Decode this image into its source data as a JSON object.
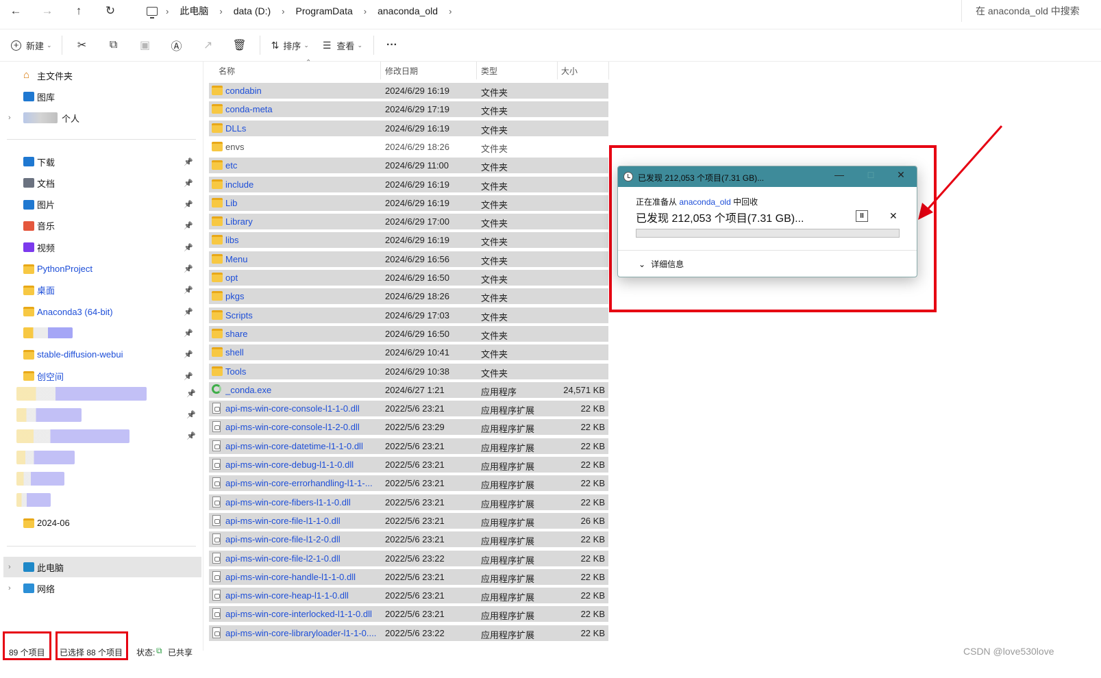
{
  "nav": {
    "back": "←",
    "forward": "→",
    "up": "↑",
    "refresh": "↻"
  },
  "breadcrumb": [
    "此电脑",
    "data (D:)",
    "ProgramData",
    "anaconda_old"
  ],
  "search": {
    "placeholder": "在 anaconda_old 中搜索"
  },
  "toolbar": {
    "new_label": "新建",
    "sort_label": "排序",
    "view_label": "查看",
    "more": "···"
  },
  "sidebar": {
    "home": "主文件夹",
    "gallery": "图库",
    "personal": "个人",
    "quick": [
      {
        "label": "下载",
        "icon": "download-icon"
      },
      {
        "label": "文档",
        "icon": "document-icon"
      },
      {
        "label": "图片",
        "icon": "pictures-icon"
      },
      {
        "label": "音乐",
        "icon": "music-icon"
      },
      {
        "label": "视频",
        "icon": "video-icon"
      },
      {
        "label": "PythonProject",
        "icon": "folder-icon"
      },
      {
        "label": "桌面",
        "icon": "folder-icon"
      },
      {
        "label": "Anaconda3 (64-bit)",
        "icon": "folder-icon"
      },
      {
        "label": "",
        "icon": "folder-icon"
      },
      {
        "label": "stable-diffusion-webui",
        "icon": "folder-icon"
      },
      {
        "label": "创空间",
        "icon": "folder-icon"
      }
    ],
    "last_folder": "2024-06",
    "this_pc": "此电脑",
    "network": "网络"
  },
  "columns": {
    "name": "名称",
    "date": "修改日期",
    "type": "类型",
    "size": "大小"
  },
  "files": [
    {
      "name": "condabin",
      "date": "2024/6/29 16:19",
      "type": "文件夹",
      "size": "",
      "kind": "folder",
      "selected": true
    },
    {
      "name": "conda-meta",
      "date": "2024/6/29 17:19",
      "type": "文件夹",
      "size": "",
      "kind": "folder",
      "selected": true
    },
    {
      "name": "DLLs",
      "date": "2024/6/29 16:19",
      "type": "文件夹",
      "size": "",
      "kind": "folder",
      "selected": true
    },
    {
      "name": "envs",
      "date": "2024/6/29 18:26",
      "type": "文件夹",
      "size": "",
      "kind": "folder",
      "selected": false
    },
    {
      "name": "etc",
      "date": "2024/6/29 11:00",
      "type": "文件夹",
      "size": "",
      "kind": "folder",
      "selected": true
    },
    {
      "name": "include",
      "date": "2024/6/29 16:19",
      "type": "文件夹",
      "size": "",
      "kind": "folder",
      "selected": true
    },
    {
      "name": "Lib",
      "date": "2024/6/29 16:19",
      "type": "文件夹",
      "size": "",
      "kind": "folder",
      "selected": true
    },
    {
      "name": "Library",
      "date": "2024/6/29 17:00",
      "type": "文件夹",
      "size": "",
      "kind": "folder",
      "selected": true
    },
    {
      "name": "libs",
      "date": "2024/6/29 16:19",
      "type": "文件夹",
      "size": "",
      "kind": "folder",
      "selected": true
    },
    {
      "name": "Menu",
      "date": "2024/6/29 16:56",
      "type": "文件夹",
      "size": "",
      "kind": "folder",
      "selected": true
    },
    {
      "name": "opt",
      "date": "2024/6/29 16:50",
      "type": "文件夹",
      "size": "",
      "kind": "folder",
      "selected": true
    },
    {
      "name": "pkgs",
      "date": "2024/6/29 18:26",
      "type": "文件夹",
      "size": "",
      "kind": "folder",
      "selected": true
    },
    {
      "name": "Scripts",
      "date": "2024/6/29 17:03",
      "type": "文件夹",
      "size": "",
      "kind": "folder",
      "selected": true
    },
    {
      "name": "share",
      "date": "2024/6/29 16:50",
      "type": "文件夹",
      "size": "",
      "kind": "folder",
      "selected": true
    },
    {
      "name": "shell",
      "date": "2024/6/29 10:41",
      "type": "文件夹",
      "size": "",
      "kind": "folder",
      "selected": true
    },
    {
      "name": "Tools",
      "date": "2024/6/29 10:38",
      "type": "文件夹",
      "size": "",
      "kind": "folder",
      "selected": true
    },
    {
      "name": "_conda.exe",
      "date": "2024/6/27 1:21",
      "type": "应用程序",
      "size": "24,571 KB",
      "kind": "exe",
      "selected": true
    },
    {
      "name": "api-ms-win-core-console-l1-1-0.dll",
      "date": "2022/5/6 23:21",
      "type": "应用程序扩展",
      "size": "22 KB",
      "kind": "dll",
      "selected": true
    },
    {
      "name": "api-ms-win-core-console-l1-2-0.dll",
      "date": "2022/5/6 23:29",
      "type": "应用程序扩展",
      "size": "22 KB",
      "kind": "dll",
      "selected": true
    },
    {
      "name": "api-ms-win-core-datetime-l1-1-0.dll",
      "date": "2022/5/6 23:21",
      "type": "应用程序扩展",
      "size": "22 KB",
      "kind": "dll",
      "selected": true
    },
    {
      "name": "api-ms-win-core-debug-l1-1-0.dll",
      "date": "2022/5/6 23:21",
      "type": "应用程序扩展",
      "size": "22 KB",
      "kind": "dll",
      "selected": true
    },
    {
      "name": "api-ms-win-core-errorhandling-l1-1-...",
      "date": "2022/5/6 23:21",
      "type": "应用程序扩展",
      "size": "22 KB",
      "kind": "dll",
      "selected": true
    },
    {
      "name": "api-ms-win-core-fibers-l1-1-0.dll",
      "date": "2022/5/6 23:21",
      "type": "应用程序扩展",
      "size": "22 KB",
      "kind": "dll",
      "selected": true
    },
    {
      "name": "api-ms-win-core-file-l1-1-0.dll",
      "date": "2022/5/6 23:21",
      "type": "应用程序扩展",
      "size": "26 KB",
      "kind": "dll",
      "selected": true
    },
    {
      "name": "api-ms-win-core-file-l1-2-0.dll",
      "date": "2022/5/6 23:21",
      "type": "应用程序扩展",
      "size": "22 KB",
      "kind": "dll",
      "selected": true
    },
    {
      "name": "api-ms-win-core-file-l2-1-0.dll",
      "date": "2022/5/6 23:22",
      "type": "应用程序扩展",
      "size": "22 KB",
      "kind": "dll",
      "selected": true
    },
    {
      "name": "api-ms-win-core-handle-l1-1-0.dll",
      "date": "2022/5/6 23:21",
      "type": "应用程序扩展",
      "size": "22 KB",
      "kind": "dll",
      "selected": true
    },
    {
      "name": "api-ms-win-core-heap-l1-1-0.dll",
      "date": "2022/5/6 23:21",
      "type": "应用程序扩展",
      "size": "22 KB",
      "kind": "dll",
      "selected": true
    },
    {
      "name": "api-ms-win-core-interlocked-l1-1-0.dll",
      "date": "2022/5/6 23:21",
      "type": "应用程序扩展",
      "size": "22 KB",
      "kind": "dll",
      "selected": true
    },
    {
      "name": "api-ms-win-core-libraryloader-l1-1-0....",
      "date": "2022/5/6 23:22",
      "type": "应用程序扩展",
      "size": "22 KB",
      "kind": "dll",
      "selected": true
    }
  ],
  "status": {
    "count": "89 个项目",
    "selected": "已选择 88 个项目",
    "state_label": "状态:",
    "shared": "已共享"
  },
  "dialog": {
    "title": "已发现 212,053 个项目(7.31 GB)...",
    "sub_prefix": "正在准备从 ",
    "sub_link": "anaconda_old",
    "sub_suffix": " 中回收",
    "main": "已发现 212,053 个项目(7.31 GB)...",
    "progress": 0,
    "details": "详细信息",
    "minimize": "—",
    "maximize": "□",
    "close": "✕"
  },
  "watermark": "CSDN @love530love",
  "colors": {
    "annotation_red": "#e60012",
    "dialog_title": "#3e8b9a",
    "link": "#1d4ed8",
    "selection": "#d9d9d9"
  }
}
